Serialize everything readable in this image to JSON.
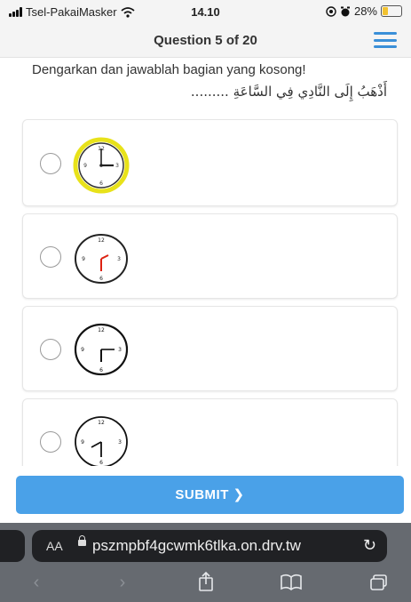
{
  "status_bar": {
    "carrier": "Tsel-PakaiMasker",
    "time": "14.10",
    "battery": "28%",
    "battery_level": 0.28
  },
  "header": {
    "title": "Question 5 of 20",
    "menu_icon": "hamburger-menu-icon"
  },
  "question": {
    "prompt": "Dengarkan dan jawablah bagian yang kosong!",
    "arabic_text": "أَذْهَبُ إِلَى النَّادِي فِي السَّاعَةِ ........."
  },
  "options": [
    {
      "id": "option-1",
      "icon": "clock-icon",
      "selected": false,
      "clock_time": "3:00"
    },
    {
      "id": "option-2",
      "icon": "clock-icon",
      "selected": false,
      "clock_time": "6:10"
    },
    {
      "id": "option-3",
      "icon": "clock-icon",
      "selected": false,
      "clock_time": "6:15"
    },
    {
      "id": "option-4",
      "icon": "clock-icon",
      "selected": false,
      "clock_time": "6:40"
    }
  ],
  "submit": {
    "label": "SUBMIT ❯"
  },
  "browser": {
    "text_size_label": "AA",
    "url": "pszmpbf4gcwmk6tlka.on.drv.tw",
    "icons": [
      "lock-icon",
      "reload-icon",
      "back-icon",
      "forward-icon",
      "share-icon",
      "bookmarks-icon",
      "tabs-icon"
    ]
  },
  "colors": {
    "accent": "#4aa1e8",
    "menu": "#3a8fd8",
    "highlight_ring": "#e8e21a"
  }
}
